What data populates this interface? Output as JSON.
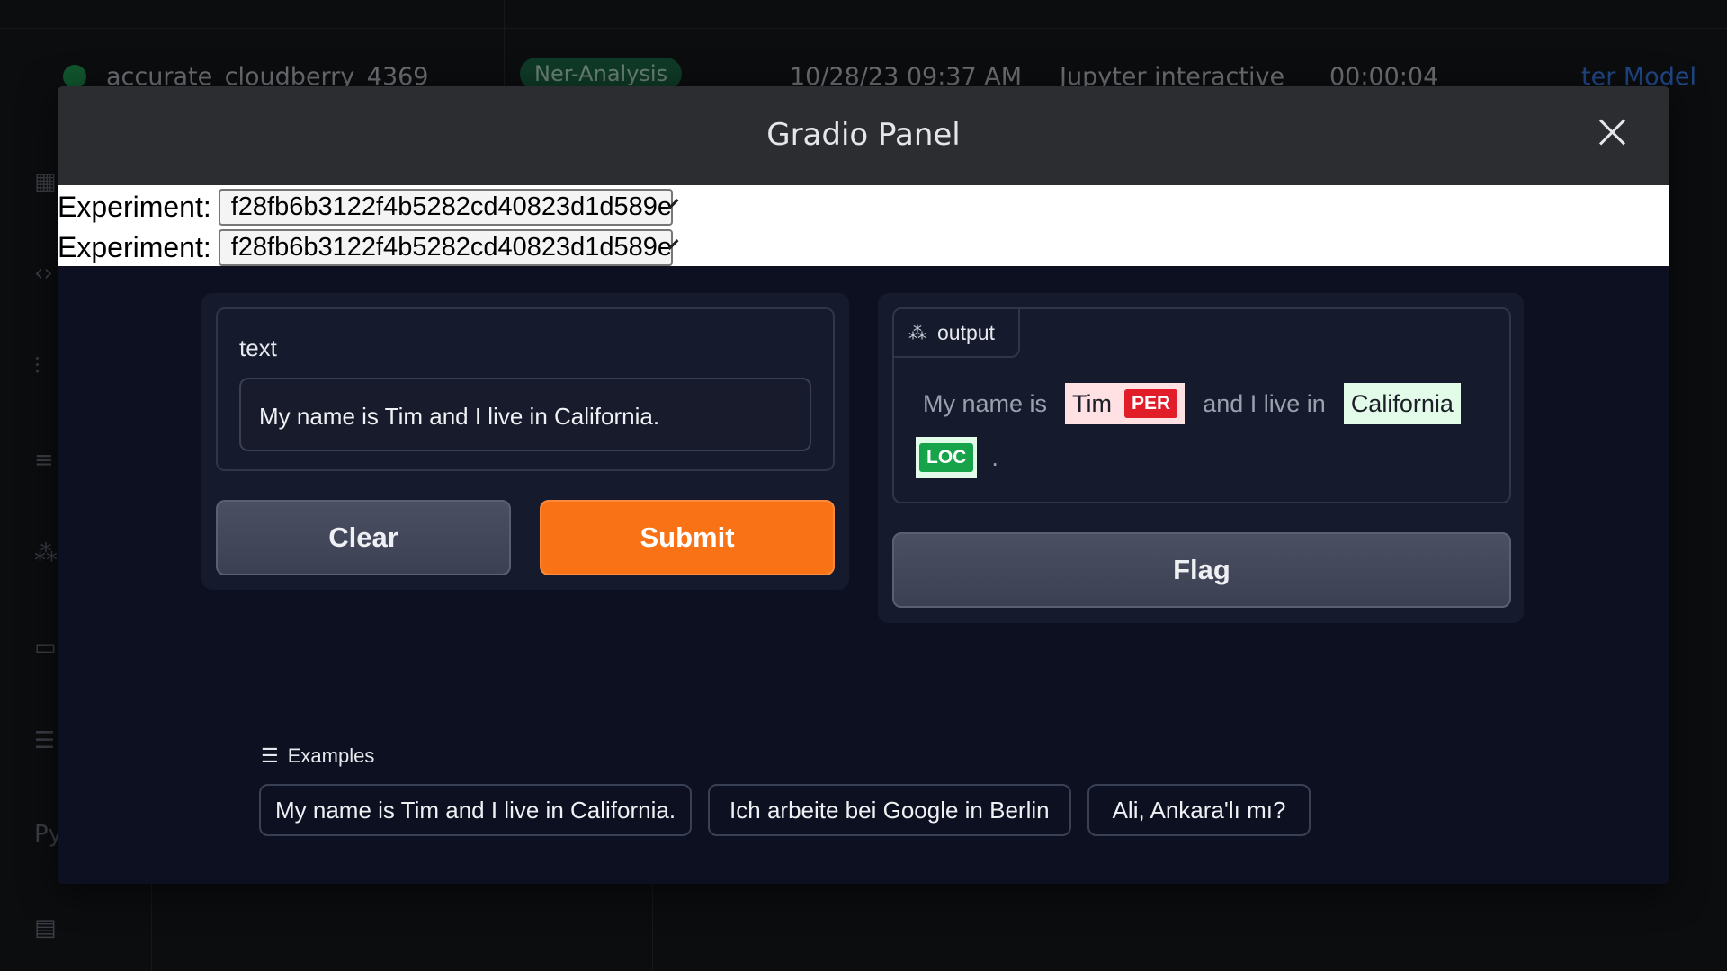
{
  "background": {
    "row": {
      "name": "accurate_cloudberry_4369",
      "tag": "Ner-Analysis",
      "time": "10/28/23 09:37 AM",
      "file": "Jupyter interactive",
      "duration": "00:00:04",
      "link": "ter Model"
    }
  },
  "modal": {
    "title": "Gradio Panel",
    "close_icon": "close-icon"
  },
  "experiments": [
    {
      "label": "Experiment:",
      "value": "f28fb6b3122f4b5282cd40823d1d589e"
    },
    {
      "label": "Experiment:",
      "value": "f28fb6b3122f4b5282cd40823d1d589e"
    }
  ],
  "input": {
    "label": "text",
    "value": "My name is Tim and I live in California."
  },
  "buttons": {
    "clear": "Clear",
    "submit": "Submit",
    "flag": "Flag"
  },
  "output": {
    "tab_label": "output",
    "icon": "highlight-text-icon",
    "segments": {
      "t1": "My name is",
      "e1": "Tim",
      "e1_label": "PER",
      "t2": "and I live in",
      "e2": "California",
      "e2_label": "LOC",
      "t3": "."
    }
  },
  "examples": {
    "label": "Examples",
    "items": [
      "My name is Tim and I live in California.",
      "Ich arbeite bei Google in Berlin",
      "Ali, Ankara'lı mı?"
    ]
  },
  "colors": {
    "submit": "#f97316",
    "per_badge": "#e11d2a",
    "loc_badge": "#16a34a",
    "status_dot": "#1f9d55"
  }
}
